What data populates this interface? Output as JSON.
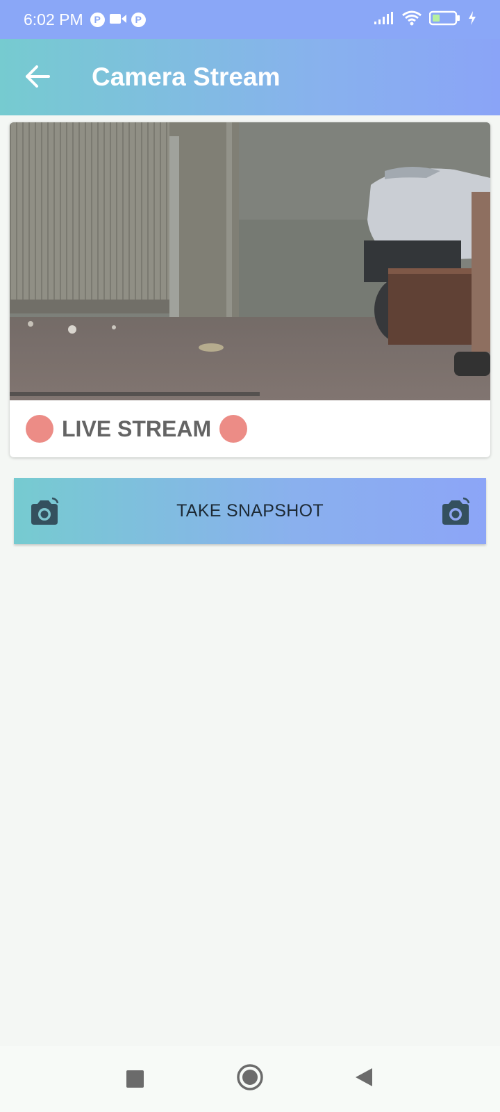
{
  "status_bar": {
    "time": "6:02 PM",
    "badge_1": "P",
    "badge_2": "P",
    "icons": [
      "video-icon",
      "signal-icon",
      "wifi-icon",
      "battery-icon",
      "charging-icon"
    ]
  },
  "app_bar": {
    "title": "Camera Stream",
    "back_icon": "arrow-left-icon"
  },
  "stream": {
    "live_label": "LIVE STREAM",
    "indicator_color": "#ec8c86"
  },
  "snapshot": {
    "label": "TAKE SNAPSHOT",
    "icon": "camera-switch-icon"
  },
  "nav_bar": {
    "icons": [
      "recents-icon",
      "home-icon",
      "back-icon"
    ]
  },
  "colors": {
    "status_bar": "#8aa7f7",
    "gradient_start": "#76cbd0",
    "gradient_end": "#8aa4f7",
    "background": "#f4f7f4",
    "label_text": "#646464"
  }
}
